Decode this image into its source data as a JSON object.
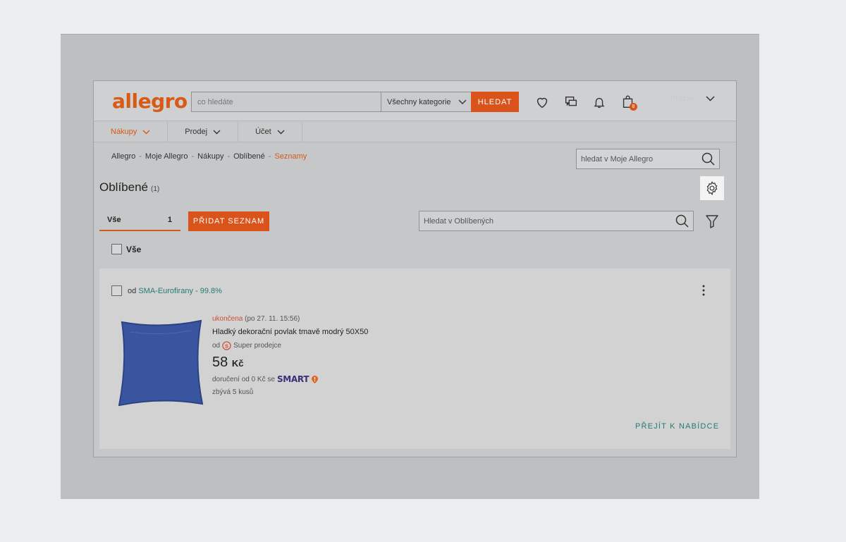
{
  "header": {
    "logo": "allegro",
    "search_placeholder": "co hledáte",
    "category": "Všechny kategorie",
    "search_button": "HLEDAT",
    "cart_count": "8",
    "user_name": "Pražák"
  },
  "nav": {
    "items": [
      {
        "label": "Nákupy"
      },
      {
        "label": "Prodej"
      },
      {
        "label": "Účet"
      }
    ]
  },
  "breadcrumb": {
    "items": [
      "Allegro",
      "Moje Allegro",
      "Nákupy",
      "Oblíbené"
    ],
    "current": "Seznamy",
    "separator": "-"
  },
  "my_allegro_search": {
    "placeholder": "hledat v Moje Allegro"
  },
  "page": {
    "title": "Oblíbené",
    "count": "(1)"
  },
  "tabs": {
    "all_label": "Vše",
    "all_count": "1",
    "add_list_button": "PŘIDAT SEZNAM"
  },
  "favorites_search": {
    "placeholder": "Hledat v Oblíbených"
  },
  "select_all_label": "Vše",
  "item": {
    "seller_prefix": "od",
    "seller": "SMA-Eurofirany - 99.8%",
    "status": "ukončena",
    "status_date": "(po 27. 11. 15:56)",
    "title": "Hladký dekorační povlak tmavě modrý 50X50",
    "seller_type_prefix": "od",
    "seller_type": "Super prodejce",
    "price": "58",
    "currency": "Kč",
    "delivery": "doručení od 0 Kč se",
    "smart": "SMART",
    "remaining": "zbývá 5 kusů",
    "goto_button": "PŘEJÍT K NABÍDCE"
  },
  "colors": {
    "brand_orange": "#d75a16",
    "link_teal": "#257b71",
    "smart_purple": "#3c2f78"
  }
}
